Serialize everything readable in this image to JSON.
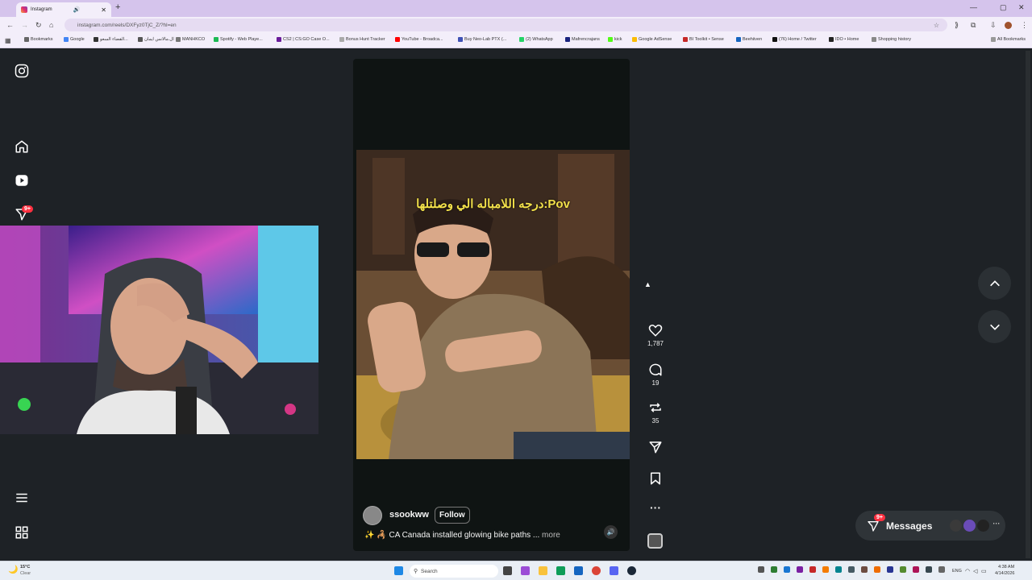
{
  "browser": {
    "tab_title": "Instagram",
    "url": "instagram.com/reels/DXFyz0TjC_Z/?hl=en",
    "new_tab": "+",
    "bookmarks": [
      {
        "label": "Bookmarks",
        "color": "#666666"
      },
      {
        "label": "Google",
        "color": "#4285f4"
      },
      {
        "label": "القضاء السعو...",
        "color": "#333333"
      },
      {
        "label": "ال.مالانس ايمان",
        "color": "#555555"
      },
      {
        "label": "MANHKCO",
        "color": "#777777"
      },
      {
        "label": "Spotify - Web Playe...",
        "color": "#1db954"
      },
      {
        "label": "CS2 | CS:GO Case O...",
        "color": "#6a1b9a"
      },
      {
        "label": "Bonus Hunt Tracker",
        "color": "#aaaaaa"
      },
      {
        "label": "YouTube - Broadca...",
        "color": "#ff0000"
      },
      {
        "label": "Buy Neo-Lab PTX (...",
        "color": "#3f51b5"
      },
      {
        "label": "(2) WhatsApp",
        "color": "#25d366"
      },
      {
        "label": "Mafrencrajans",
        "color": "#1a237e"
      },
      {
        "label": "kick",
        "color": "#53fc18"
      },
      {
        "label": "Google AdSense",
        "color": "#fbbc04"
      },
      {
        "label": "BI Toolkit • Sense",
        "color": "#c62828"
      },
      {
        "label": "Beehiiven",
        "color": "#1565c0"
      },
      {
        "label": "(76) Home / Twitter",
        "color": "#111111"
      },
      {
        "label": "IDO • Home",
        "color": "#222222"
      },
      {
        "label": "Shopping history",
        "color": "#888888"
      }
    ],
    "all_bookmarks": "All Bookmarks"
  },
  "sidebar": {
    "notifications_badge": "9+"
  },
  "reel": {
    "video_caption": "درجه اللامباله الي وصلتلها:Pov",
    "username": "ssookww",
    "follow_label": "Follow",
    "caption_prefix": "✨ 🦂",
    "caption": "CA Canada installed glowing bike paths ...",
    "more_label": "more",
    "likes": "1,787",
    "comments": "19",
    "reposts": "35"
  },
  "messages": {
    "label": "Messages",
    "badge": "9+"
  },
  "taskbar": {
    "weather_temp": "15°C",
    "weather_desc": "Clear",
    "search_placeholder": "Search",
    "lang": "ENG",
    "time": "4:38 AM",
    "date": "4/14/2026"
  },
  "colors": {
    "accent_badge": "#ff3040",
    "page_bg": "#1e2226",
    "caption_yellow": "#f2e04a"
  }
}
